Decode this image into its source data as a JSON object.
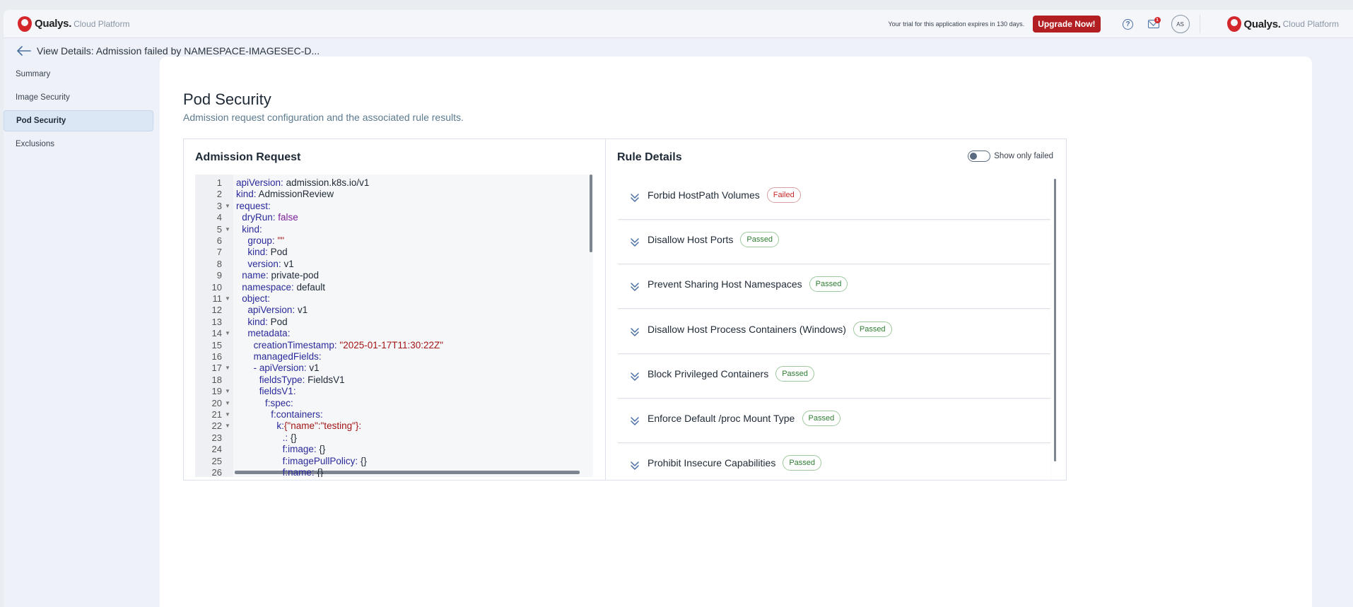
{
  "topbar": {
    "brand_name": "Qualys.",
    "brand_sub": "Cloud Platform",
    "trial_text": "Your trial for this application expires in 130 days.",
    "upgrade_label": "Upgrade Now!",
    "help_glyph": "?",
    "mail_badge": "1",
    "avatar_initials": "AS"
  },
  "breadcrumb": {
    "title": "View Details: Admission failed by NAMESPACE-IMAGESEC-D..."
  },
  "sidebar": {
    "items": [
      {
        "label": "Summary"
      },
      {
        "label": "Image Security"
      },
      {
        "label": "Pod Security",
        "active": true
      },
      {
        "label": "Exclusions"
      }
    ]
  },
  "page": {
    "title": "Pod Security",
    "subtitle": "Admission request configuration and the associated rule results."
  },
  "admission": {
    "title": "Admission Request",
    "lines": [
      {
        "n": "1",
        "fold": false,
        "indent": 0,
        "key": "apiVersion",
        "sep": ": ",
        "val": "admission.k8s.io/v1",
        "vt": "plain"
      },
      {
        "n": "2",
        "fold": false,
        "indent": 0,
        "key": "kind",
        "sep": ": ",
        "val": "AdmissionReview",
        "vt": "plain"
      },
      {
        "n": "3",
        "fold": true,
        "indent": 0,
        "key": "request",
        "sep": ":",
        "val": "",
        "vt": "plain"
      },
      {
        "n": "4",
        "fold": false,
        "indent": 1,
        "key": "dryRun",
        "sep": ": ",
        "val": "false",
        "vt": "bool"
      },
      {
        "n": "5",
        "fold": true,
        "indent": 1,
        "key": "kind",
        "sep": ":",
        "val": "",
        "vt": "plain"
      },
      {
        "n": "6",
        "fold": false,
        "indent": 2,
        "key": "group",
        "sep": ": ",
        "val": "\"\"",
        "vt": "str"
      },
      {
        "n": "7",
        "fold": false,
        "indent": 2,
        "key": "kind",
        "sep": ": ",
        "val": "Pod",
        "vt": "plain"
      },
      {
        "n": "8",
        "fold": false,
        "indent": 2,
        "key": "version",
        "sep": ": ",
        "val": "v1",
        "vt": "plain"
      },
      {
        "n": "9",
        "fold": false,
        "indent": 1,
        "key": "name",
        "sep": ": ",
        "val": "private-pod",
        "vt": "plain"
      },
      {
        "n": "10",
        "fold": false,
        "indent": 1,
        "key": "namespace",
        "sep": ": ",
        "val": "default",
        "vt": "plain"
      },
      {
        "n": "11",
        "fold": true,
        "indent": 1,
        "key": "object",
        "sep": ":",
        "val": "",
        "vt": "plain"
      },
      {
        "n": "12",
        "fold": false,
        "indent": 2,
        "key": "apiVersion",
        "sep": ": ",
        "val": "v1",
        "vt": "plain"
      },
      {
        "n": "13",
        "fold": false,
        "indent": 2,
        "key": "kind",
        "sep": ": ",
        "val": "Pod",
        "vt": "plain"
      },
      {
        "n": "14",
        "fold": true,
        "indent": 2,
        "key": "metadata",
        "sep": ":",
        "val": "",
        "vt": "plain"
      },
      {
        "n": "15",
        "fold": false,
        "indent": 3,
        "key": "creationTimestamp",
        "sep": ": ",
        "val": "\"2025-01-17T11:30:22Z\"",
        "vt": "str"
      },
      {
        "n": "16",
        "fold": false,
        "indent": 3,
        "key": "managedFields",
        "sep": ":",
        "val": "",
        "vt": "plain"
      },
      {
        "n": "17",
        "fold": true,
        "indent": 3,
        "key": "- apiVersion",
        "sep": ": ",
        "val": "v1",
        "vt": "plain"
      },
      {
        "n": "18",
        "fold": false,
        "indent": 4,
        "key": "fieldsType",
        "sep": ": ",
        "val": "FieldsV1",
        "vt": "plain"
      },
      {
        "n": "19",
        "fold": true,
        "indent": 4,
        "key": "fieldsV1",
        "sep": ":",
        "val": "",
        "vt": "plain"
      },
      {
        "n": "20",
        "fold": true,
        "indent": 5,
        "key": "f:spec",
        "sep": ":",
        "val": "",
        "vt": "plain"
      },
      {
        "n": "21",
        "fold": true,
        "indent": 6,
        "key": "f:containers",
        "sep": ":",
        "val": "",
        "vt": "plain"
      },
      {
        "n": "22",
        "fold": true,
        "indent": 7,
        "key": "k:",
        "sep": "",
        "val": "{\"name\":\"testing\"}:",
        "vt": "str"
      },
      {
        "n": "23",
        "fold": false,
        "indent": 8,
        "key": ".",
        "sep": ": ",
        "val": "{}",
        "vt": "plain"
      },
      {
        "n": "24",
        "fold": false,
        "indent": 8,
        "key": "f:image",
        "sep": ": ",
        "val": "{}",
        "vt": "plain"
      },
      {
        "n": "25",
        "fold": false,
        "indent": 8,
        "key": "f:imagePullPolicy",
        "sep": ": ",
        "val": "{}",
        "vt": "plain"
      },
      {
        "n": "26",
        "fold": false,
        "indent": 8,
        "key": "f:name",
        "sep": ": ",
        "val": "{}",
        "vt": "plain"
      }
    ]
  },
  "rules": {
    "title": "Rule Details",
    "toggle_label": "Show only failed",
    "items": [
      {
        "name": "Forbid HostPath Volumes",
        "status": "Failed"
      },
      {
        "name": "Disallow Host Ports",
        "status": "Passed"
      },
      {
        "name": "Prevent Sharing Host Namespaces",
        "status": "Passed"
      },
      {
        "name": "Disallow Host Process Containers (Windows)",
        "status": "Passed"
      },
      {
        "name": "Block Privileged Containers",
        "status": "Passed"
      },
      {
        "name": "Enforce Default /proc Mount Type",
        "status": "Passed"
      },
      {
        "name": "Prohibit Insecure Capabilities",
        "status": "Passed"
      }
    ]
  },
  "colors": {
    "brand_red": "#d4272c",
    "upgrade_bg": "#b31e22",
    "active_nav": "#dce7f5",
    "failed": "#c62828",
    "passed": "#2e7d32"
  }
}
